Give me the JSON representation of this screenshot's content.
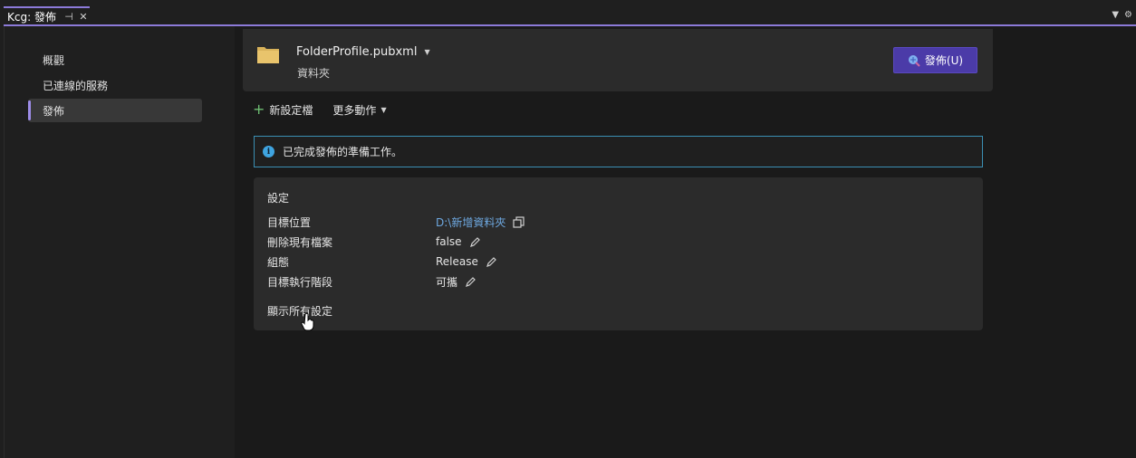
{
  "tab": {
    "title": "Kcg: 發佈"
  },
  "sidebar": {
    "items": [
      {
        "label": "概觀"
      },
      {
        "label": "已連線的服務"
      },
      {
        "label": "發佈"
      }
    ]
  },
  "profile": {
    "name": "FolderProfile.pubxml",
    "type": "資料夾",
    "publish_label": "發佈(U)"
  },
  "toolbar": {
    "new_profile_label": "新設定檔",
    "more_actions_label": "更多動作"
  },
  "info": {
    "message": "已完成發佈的準備工作。"
  },
  "settings": {
    "title": "設定",
    "rows": [
      {
        "label": "目標位置",
        "value": "D:\\新增資料夾"
      },
      {
        "label": "刪除現有檔案",
        "value": "false"
      },
      {
        "label": "組態",
        "value": "Release"
      },
      {
        "label": "目標執行階段",
        "value": "可攜"
      }
    ],
    "show_all_label": "顯示所有設定"
  },
  "colors": {
    "accent": "#8c7ad9",
    "publish_button": "#4b3ba8",
    "info_border": "#3b8fb3",
    "link": "#6ea8e0"
  },
  "icons": [
    "pin-icon",
    "close-icon",
    "chevron-down-icon",
    "gear-icon",
    "folder-icon",
    "publish-icon",
    "plus-icon",
    "info-icon",
    "copy-icon",
    "edit-icon",
    "hand-cursor-icon"
  ]
}
